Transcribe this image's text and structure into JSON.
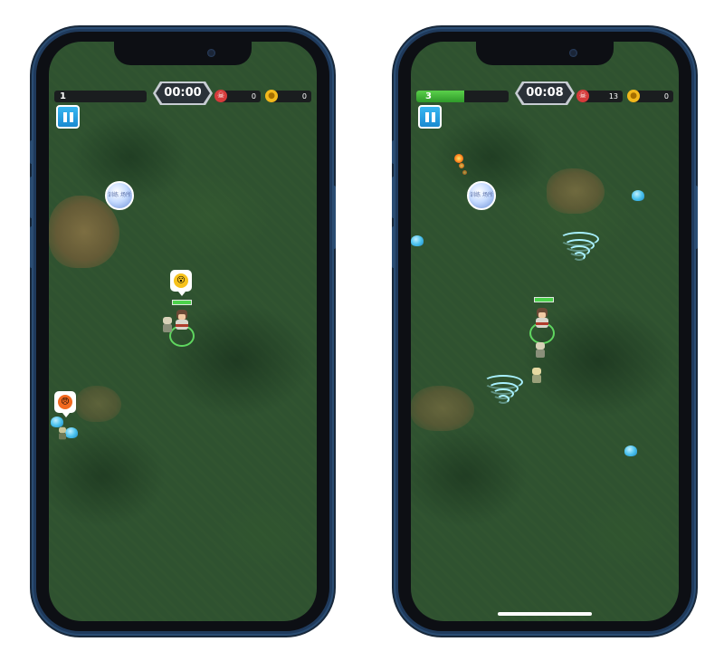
{
  "screens": [
    {
      "level": "1",
      "xp_progress": 0,
      "timer": "00:00",
      "kills": "0",
      "coins": "0",
      "orb_text": "训练 场所",
      "player_emote": "shocked-emoji",
      "enemy_emote": "angry-emoji"
    },
    {
      "level": "3",
      "xp_progress": 0.52,
      "timer": "00:08",
      "kills": "13",
      "coins": "0",
      "orb_text": "训练 场所"
    }
  ],
  "colors": {
    "grass": "#2f5230",
    "hud_dark": "#1a1d1f",
    "xp_green": "#4bc83e",
    "pause_blue": "#2aa3e8",
    "skull_red": "#d63b3b",
    "coin_gold": "#f2b81c",
    "slime_blue": "#4cc2ee",
    "tornado_cyan": "#a9f1ff",
    "phone_frame": "#1f3a5c"
  },
  "icons": [
    "pause-icon",
    "skull-icon",
    "coin-icon",
    "orb-icon",
    "slime-icon",
    "tornado-icon",
    "fireball-icon"
  ]
}
